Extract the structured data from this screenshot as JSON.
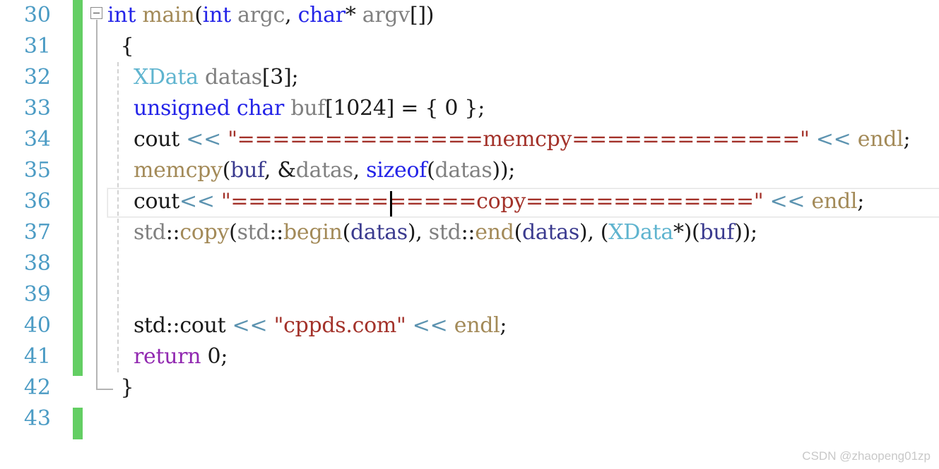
{
  "editor": {
    "language": "cpp",
    "first_line_number": 30,
    "line_height_px": 44,
    "colors": {
      "background": "#ffffff",
      "line_number": "#4b9bc4",
      "change_bar_green": "#63ce63",
      "keyword_blue": "#2424e8",
      "keyword_purple": "#9128b0",
      "type_teal": "#5fb4cf",
      "function_tan": "#a38a58",
      "variable_gray": "#808080",
      "string_red": "#a3322a",
      "operator_blue": "#5c93b0",
      "plain_text": "#1a1a1a",
      "current_line_border": "#e4e4e4",
      "indent_guide": "#d2d2d2",
      "watermark": "#c8c8c8"
    },
    "current_line": 36,
    "caret_line": 36
  },
  "gutter": {
    "line_numbers": [
      "30",
      "31",
      "32",
      "33",
      "34",
      "35",
      "36",
      "37",
      "38",
      "39",
      "40",
      "41",
      "42",
      "43"
    ],
    "fold_marker": "collapse-minus-box"
  },
  "lines": [
    {
      "number": "30",
      "tokens": [
        {
          "t": "int",
          "c": "t-kw"
        },
        {
          "t": " ",
          "c": "t-plain"
        },
        {
          "t": "main",
          "c": "t-fn"
        },
        {
          "t": "(",
          "c": "t-plain"
        },
        {
          "t": "int",
          "c": "t-kw"
        },
        {
          "t": " ",
          "c": "t-plain"
        },
        {
          "t": "argc",
          "c": "t-var"
        },
        {
          "t": ", ",
          "c": "t-plain"
        },
        {
          "t": "char",
          "c": "t-kw"
        },
        {
          "t": "* ",
          "c": "t-plain"
        },
        {
          "t": "argv",
          "c": "t-var"
        },
        {
          "t": "[])",
          "c": "t-plain"
        }
      ]
    },
    {
      "number": "31",
      "tokens": [
        {
          "t": "  {",
          "c": "t-plain"
        }
      ]
    },
    {
      "number": "32",
      "tokens": [
        {
          "t": "    ",
          "c": "t-plain"
        },
        {
          "t": "XData",
          "c": "t-type"
        },
        {
          "t": " ",
          "c": "t-plain"
        },
        {
          "t": "datas",
          "c": "t-var"
        },
        {
          "t": "[",
          "c": "t-plain"
        },
        {
          "t": "3",
          "c": "t-num"
        },
        {
          "t": "];",
          "c": "t-plain"
        }
      ]
    },
    {
      "number": "33",
      "tokens": [
        {
          "t": "    ",
          "c": "t-plain"
        },
        {
          "t": "unsigned",
          "c": "t-kw"
        },
        {
          "t": " ",
          "c": "t-plain"
        },
        {
          "t": "char",
          "c": "t-kw"
        },
        {
          "t": " ",
          "c": "t-plain"
        },
        {
          "t": "buf",
          "c": "t-var"
        },
        {
          "t": "[",
          "c": "t-plain"
        },
        {
          "t": "1024",
          "c": "t-num"
        },
        {
          "t": "] = { ",
          "c": "t-plain"
        },
        {
          "t": "0",
          "c": "t-num"
        },
        {
          "t": " };",
          "c": "t-plain"
        }
      ]
    },
    {
      "number": "34",
      "tokens": [
        {
          "t": "    ",
          "c": "t-plain"
        },
        {
          "t": "cout",
          "c": "t-plain"
        },
        {
          "t": " ",
          "c": "t-plain"
        },
        {
          "t": "<<",
          "c": "t-op"
        },
        {
          "t": " ",
          "c": "t-plain"
        },
        {
          "t": "\"==============memcpy=============\"",
          "c": "t-str"
        },
        {
          "t": " ",
          "c": "t-plain"
        },
        {
          "t": "<<",
          "c": "t-op"
        },
        {
          "t": " ",
          "c": "t-plain"
        },
        {
          "t": "endl",
          "c": "t-fn"
        },
        {
          "t": ";",
          "c": "t-plain"
        }
      ]
    },
    {
      "number": "35",
      "tokens": [
        {
          "t": "    ",
          "c": "t-plain"
        },
        {
          "t": "memcpy",
          "c": "t-fn"
        },
        {
          "t": "(",
          "c": "t-plain"
        },
        {
          "t": "buf",
          "c": "t-varb"
        },
        {
          "t": ", &",
          "c": "t-plain"
        },
        {
          "t": "datas",
          "c": "t-var"
        },
        {
          "t": ", ",
          "c": "t-plain"
        },
        {
          "t": "sizeof",
          "c": "t-kw"
        },
        {
          "t": "(",
          "c": "t-plain"
        },
        {
          "t": "datas",
          "c": "t-var"
        },
        {
          "t": "));",
          "c": "t-plain"
        }
      ]
    },
    {
      "number": "36",
      "tokens": [
        {
          "t": "    ",
          "c": "t-plain"
        },
        {
          "t": "cout",
          "c": "t-plain"
        },
        {
          "t": "<<",
          "c": "t-op"
        },
        {
          "t": " ",
          "c": "t-plain"
        },
        {
          "t": "\"==============copy=============\"",
          "c": "t-str"
        },
        {
          "t": " ",
          "c": "t-plain"
        },
        {
          "t": "<<",
          "c": "t-op"
        },
        {
          "t": " ",
          "c": "t-plain"
        },
        {
          "t": "endl",
          "c": "t-fn"
        },
        {
          "t": ";",
          "c": "t-plain"
        }
      ]
    },
    {
      "number": "37",
      "tokens": [
        {
          "t": "    ",
          "c": "t-plain"
        },
        {
          "t": "std",
          "c": "t-var"
        },
        {
          "t": "::",
          "c": "t-plain"
        },
        {
          "t": "copy",
          "c": "t-fn"
        },
        {
          "t": "(",
          "c": "t-plain"
        },
        {
          "t": "std",
          "c": "t-var"
        },
        {
          "t": "::",
          "c": "t-plain"
        },
        {
          "t": "begin",
          "c": "t-fn"
        },
        {
          "t": "(",
          "c": "t-plain"
        },
        {
          "t": "datas",
          "c": "t-varb"
        },
        {
          "t": "), ",
          "c": "t-plain"
        },
        {
          "t": "std",
          "c": "t-var"
        },
        {
          "t": "::",
          "c": "t-plain"
        },
        {
          "t": "end",
          "c": "t-fn"
        },
        {
          "t": "(",
          "c": "t-plain"
        },
        {
          "t": "datas",
          "c": "t-varb"
        },
        {
          "t": "), (",
          "c": "t-plain"
        },
        {
          "t": "XData",
          "c": "t-type"
        },
        {
          "t": "*)(",
          "c": "t-plain"
        },
        {
          "t": "buf",
          "c": "t-varb"
        },
        {
          "t": "));",
          "c": "t-plain"
        }
      ]
    },
    {
      "number": "38",
      "tokens": []
    },
    {
      "number": "39",
      "tokens": []
    },
    {
      "number": "40",
      "tokens": [
        {
          "t": "    ",
          "c": "t-plain"
        },
        {
          "t": "std",
          "c": "t-plain"
        },
        {
          "t": "::",
          "c": "t-plain"
        },
        {
          "t": "cout",
          "c": "t-plain"
        },
        {
          "t": " ",
          "c": "t-plain"
        },
        {
          "t": "<<",
          "c": "t-op"
        },
        {
          "t": " ",
          "c": "t-plain"
        },
        {
          "t": "\"cppds.com\"",
          "c": "t-str"
        },
        {
          "t": " ",
          "c": "t-plain"
        },
        {
          "t": "<<",
          "c": "t-op"
        },
        {
          "t": " ",
          "c": "t-plain"
        },
        {
          "t": "endl",
          "c": "t-fn"
        },
        {
          "t": ";",
          "c": "t-plain"
        }
      ]
    },
    {
      "number": "41",
      "tokens": [
        {
          "t": "    ",
          "c": "t-plain"
        },
        {
          "t": "return",
          "c": "t-ret"
        },
        {
          "t": " ",
          "c": "t-plain"
        },
        {
          "t": "0",
          "c": "t-num"
        },
        {
          "t": ";",
          "c": "t-plain"
        }
      ]
    },
    {
      "number": "42",
      "tokens": [
        {
          "t": "  }",
          "c": "t-plain"
        }
      ]
    },
    {
      "number": "43",
      "tokens": []
    }
  ],
  "watermark": {
    "text": "CSDN @zhaopeng01zp"
  }
}
